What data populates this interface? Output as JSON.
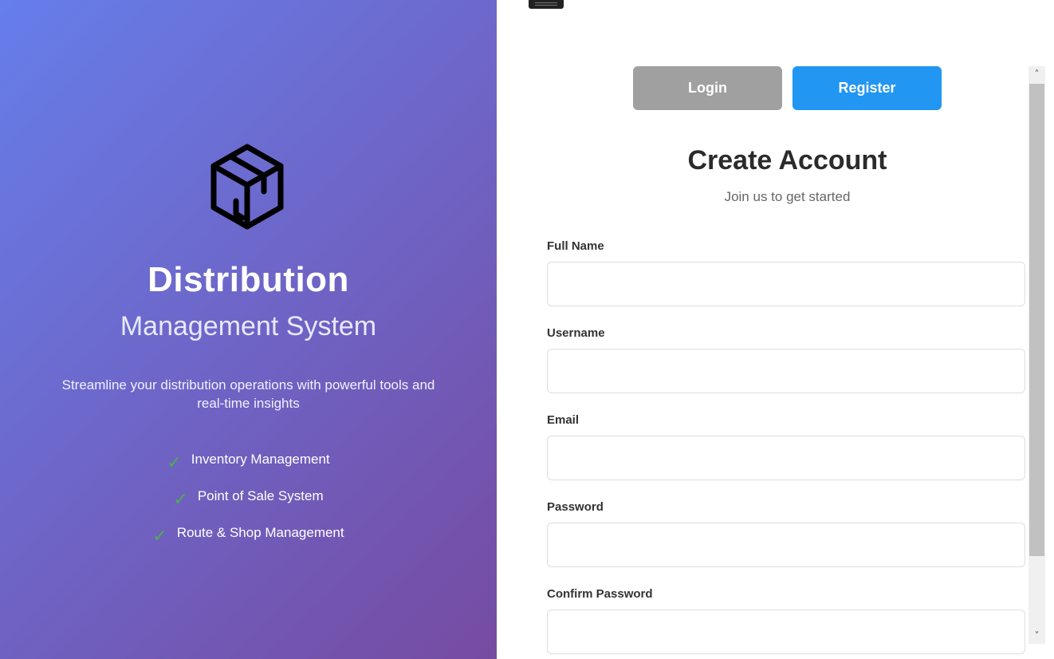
{
  "brand": {
    "title": "Distribution",
    "subtitle": "Management System",
    "tagline": "Streamline your distribution operations with powerful tools and real-time insights",
    "features": [
      "Inventory Management",
      "Point of Sale System",
      "Route & Shop Management"
    ],
    "check_glyph": "✓",
    "logo_icon": "package-box-icon"
  },
  "tabs": {
    "login": "Login",
    "register": "Register",
    "active": "Register"
  },
  "form": {
    "title": "Create Account",
    "subtitle": "Join us to get started",
    "fields": [
      {
        "label": "Full Name",
        "value": ""
      },
      {
        "label": "Username",
        "value": ""
      },
      {
        "label": "Email",
        "value": ""
      },
      {
        "label": "Password",
        "value": ""
      },
      {
        "label": "Confirm Password",
        "value": ""
      }
    ]
  },
  "colors": {
    "gradient_start": "#667eea",
    "gradient_end": "#764ba2",
    "register_active": "#2196f3",
    "login_inactive": "#a0a0a0",
    "check": "#4caf50"
  }
}
